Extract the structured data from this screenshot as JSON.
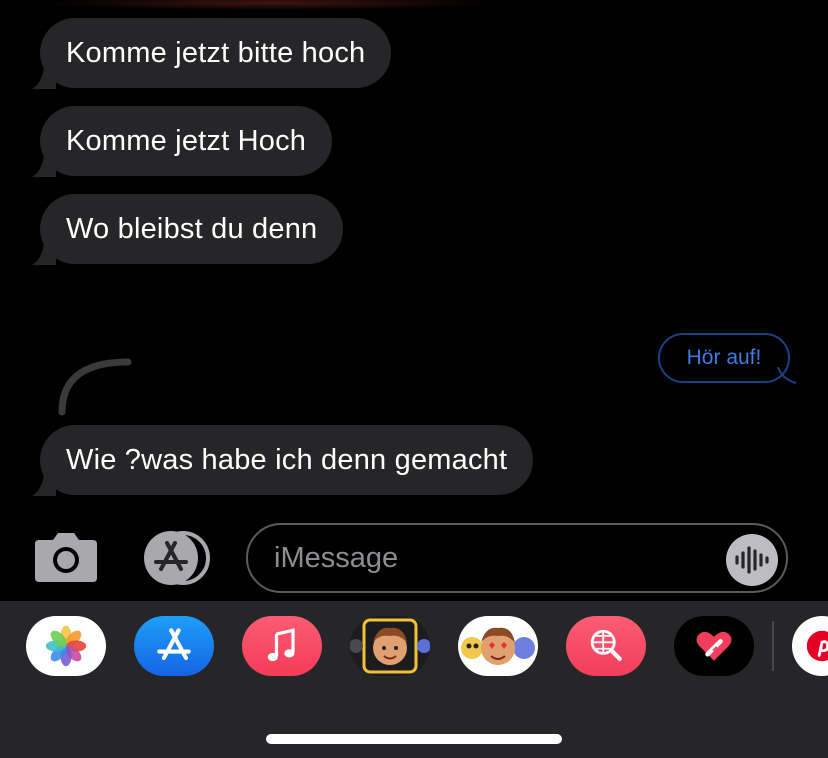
{
  "messages": {
    "incoming": [
      "Komme jetzt bitte hoch",
      "Komme jetzt Hoch",
      "Wo bleibst du denn",
      "Wie ?was habe ich denn gemacht"
    ],
    "outgoing": [
      "Hör auf!"
    ]
  },
  "composer": {
    "placeholder": "iMessage",
    "camera_icon": "camera-icon",
    "apps_icon": "app-store-icon",
    "voice_icon": "waveform-icon"
  },
  "app_drawer": {
    "apps": [
      "photos",
      "app-store",
      "music",
      "memoji",
      "animoji-stickers",
      "image-search",
      "digital-touch",
      "pinterest"
    ]
  },
  "colors": {
    "background": "#000000",
    "incoming_bubble": "#262628",
    "outgoing_outline": "#1c3f86",
    "outgoing_text": "#3d7be6",
    "drawer": "#262628"
  }
}
